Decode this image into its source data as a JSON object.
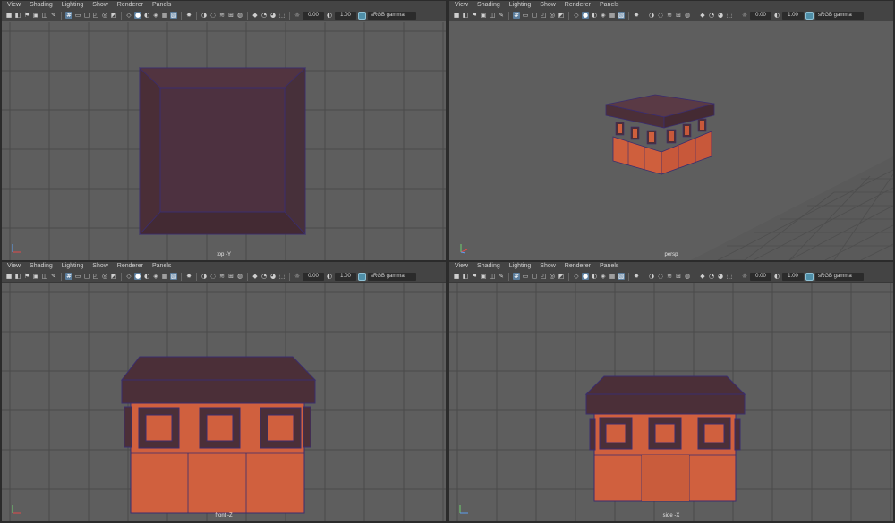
{
  "menu": [
    "View",
    "Shading",
    "Lighting",
    "Show",
    "Renderer",
    "Panels"
  ],
  "toolbar": {
    "icons": [
      "camera-icon",
      "camera-attributes-icon",
      "bookmark-icon",
      "image-plane-icon",
      "2d-pan-zoom-icon",
      "grease-pencil-icon",
      "sep",
      "grid-icon",
      "film-gate-icon",
      "resolution-gate-icon",
      "gate-mask-icon",
      "field-chart-icon",
      "safe-action-icon",
      "sep",
      "wireframe-icon",
      "smooth-shade-icon",
      "use-default-material-icon",
      "wireframe-on-shaded-icon",
      "textured-icon",
      "xray-icon",
      "sep",
      "use-all-lights-icon",
      "sep",
      "shadows-icon",
      "screen-space-ao-icon",
      "motion-blur-icon",
      "multisample-aa-icon",
      "depth-of-field-icon",
      "sep",
      "isolate-select-icon",
      "xray-active-icon",
      "xray-joints-icon",
      "backface-culling-icon",
      "sep",
      "exposure-icon"
    ],
    "active": [
      7,
      15,
      19
    ],
    "exposure": "0.00",
    "gamma": "1.00",
    "color_space": "sRGB gamma"
  },
  "panels": [
    {
      "camera": "top -Y"
    },
    {
      "camera": "persp"
    },
    {
      "camera": "front -Z"
    },
    {
      "camera": "side -X"
    }
  ],
  "colors": {
    "viewport_bg": "#5e5e5e",
    "grid": "#4a4a4a",
    "roof": "#4b2f38",
    "wall": "#d0603e",
    "outline": "#3a2d6e"
  }
}
